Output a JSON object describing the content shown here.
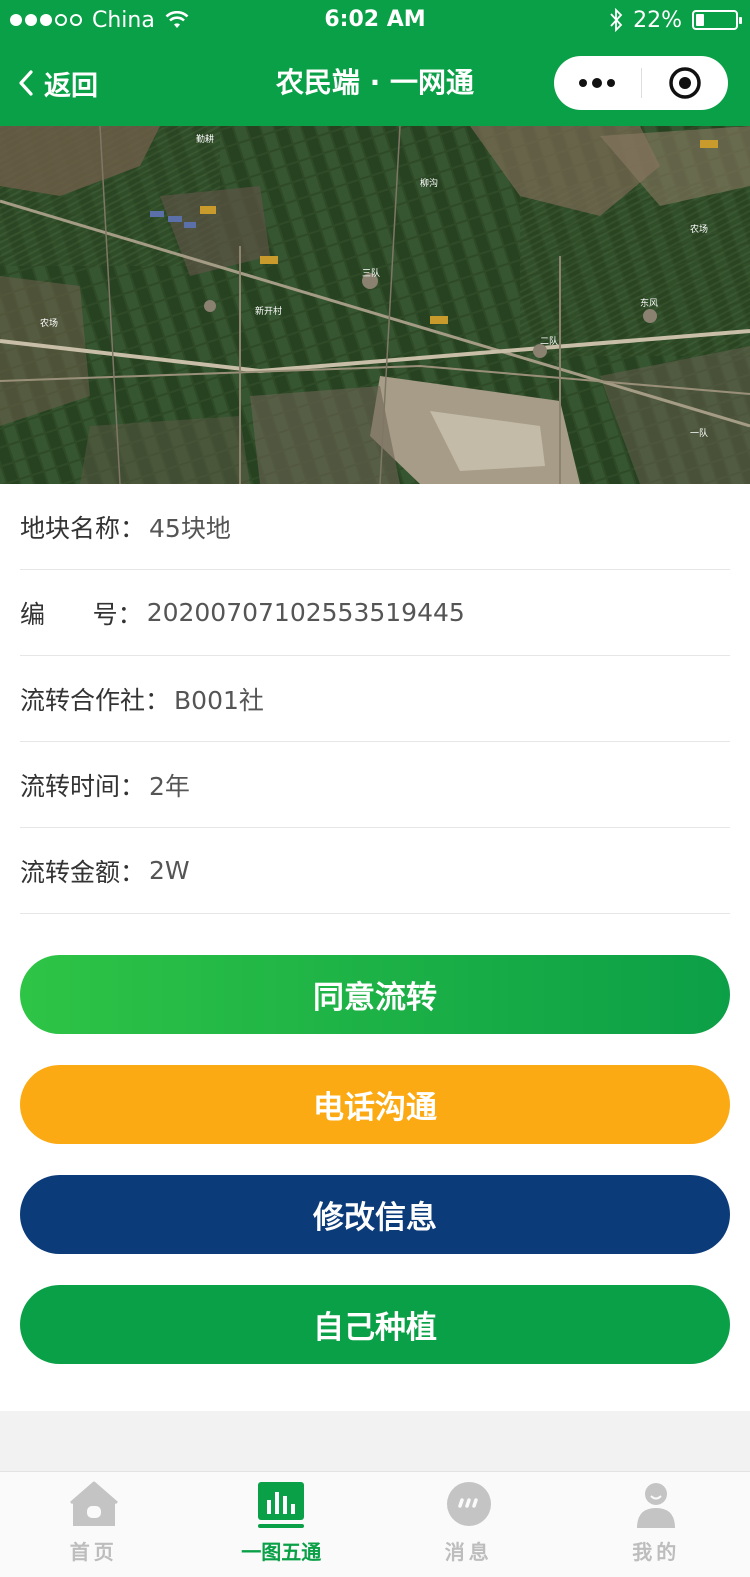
{
  "status_bar": {
    "carrier": "China",
    "time": "6:02 AM",
    "battery": "22%",
    "battery_level": 0.22
  },
  "nav": {
    "back_label": "返回",
    "title": "农民端 · 一网通"
  },
  "map": {
    "labels": [
      "勤耕",
      "农场",
      "新开村",
      "三队",
      "二队",
      "柳沟",
      "东风",
      "农场",
      "一队"
    ]
  },
  "info": {
    "rows": [
      {
        "label": "地块名称：",
        "value": "45块地"
      },
      {
        "label": "编      号：",
        "value": "20200707102553519445"
      },
      {
        "label": "流转合作社：",
        "value": "B001社"
      },
      {
        "label": "流转时间：",
        "value": "2年"
      },
      {
        "label": "流转金额：",
        "value": "2W"
      }
    ]
  },
  "actions": {
    "agree": "同意流转",
    "phone": "电话沟通",
    "edit": "修改信息",
    "self_plant": "自己种植"
  },
  "tabs": [
    {
      "label": "首页",
      "icon": "home-icon"
    },
    {
      "label": "一图五通",
      "icon": "chart-icon"
    },
    {
      "label": "消息",
      "icon": "message-icon"
    },
    {
      "label": "我的",
      "icon": "user-icon"
    }
  ],
  "colors": {
    "brand_green": "#0aa047",
    "agree_gradient_start": "#2ec446",
    "agree_gradient_end": "#0c9f47",
    "phone_orange": "#fbaa14",
    "edit_navy": "#0c3b79",
    "self_plant_green": "#0aa047"
  }
}
